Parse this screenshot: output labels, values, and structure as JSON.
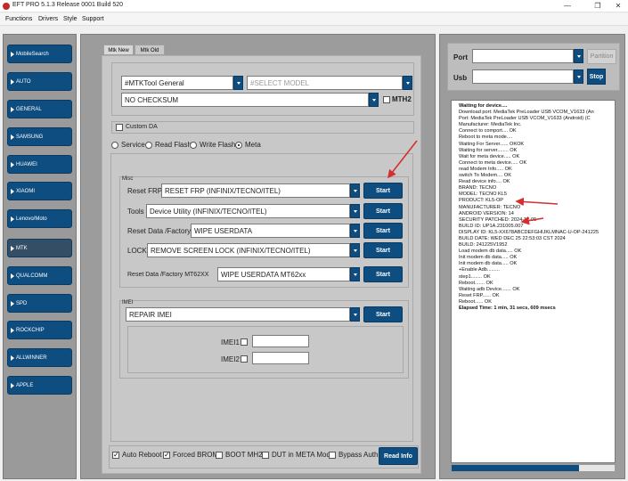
{
  "window": {
    "title": "EFT PRO 5.1.3 Release 0001 Build 520",
    "minimize": "—",
    "maximize": "❐",
    "close": "✕"
  },
  "menu": [
    "Functions",
    "Drivers",
    "Style",
    "Support"
  ],
  "sidebar": {
    "items": [
      "MobileSearch",
      "AUTO",
      "GENERAL",
      "SAMSUNG",
      "HUAWEI",
      "XIAOMI",
      "Lenovo/Moto",
      "MTK",
      "QUALCOMM",
      "SPD",
      "ROCKCHIP",
      "ALLWINNER",
      "APPLE"
    ],
    "active": "MTK"
  },
  "tabs": [
    "Mtk New",
    "Mtk Old"
  ],
  "selectors": {
    "tool": "#MTKTool General",
    "model_placeholder": "#SELECT MODEL",
    "checksum": "NO CHECKSUM",
    "mth2": "MTH2"
  },
  "custom_da": "Custom DA",
  "modes": [
    "Service",
    "Read Flash",
    "Write Flash",
    "Meta"
  ],
  "misc": {
    "title": "Misc",
    "rows": [
      {
        "label": "Reset FRP",
        "value": "RESET FRP (INFINIX/TECNO/ITEL)",
        "button": "Start"
      },
      {
        "label": "Tools",
        "value": "Device Utility (INFINIX/TECNO/ITEL)",
        "button": "Start"
      },
      {
        "label": "Reset Data /Factory",
        "value": "WIPE USERDATA",
        "button": "Start"
      },
      {
        "label": "LOCK",
        "value": "REMOVE SCREEN LOCK (INFINIX/TECNO/ITEL)",
        "button": "Start"
      },
      {
        "label": "Reset Data /Factory MT62XX",
        "value": "WIPE USERDATA  MT62xx",
        "button": "Start"
      }
    ]
  },
  "imei": {
    "title": "IMEI",
    "action": "REPAIR IMEI",
    "button": "Start",
    "imei1": "IMEI1",
    "imei2": "IMEI2"
  },
  "footer": {
    "auto_reboot": "Auto Reboot",
    "forced_brom": "Forced BROM",
    "boot_mh2": "BOOT MH2",
    "dut_meta": "DUT in META Mod",
    "bypass_auth": "Bypass Auth",
    "read_info": "Read Info"
  },
  "connection": {
    "port_label": "Port",
    "usb_label": "Usb",
    "partition": "Partition",
    "stop": "Stop"
  },
  "log": [
    {
      "t": "Waiting for device....",
      "b": true
    },
    {
      "t": "Download port: MediaTek PreLoader USB VCOM_V1633 (An",
      "b": false
    },
    {
      "t": "Port: MediaTek PreLoader USB VCOM_V1633 (Android) (C",
      "b": false
    },
    {
      "t": "Manufacturer: MediaTek Inc.",
      "b": false
    },
    {
      "t": "Connect to comport.... OK",
      "b": false
    },
    {
      "t": "Reboot to meta mode....",
      "b": false
    },
    {
      "t": "Waiting For Server...... OKOK",
      "b": false
    },
    {
      "t": "Waiting for server........ OK",
      "b": false
    },
    {
      "t": "Wait for meta device..... OK",
      "b": false
    },
    {
      "t": "Connect to meta device..... OK",
      "b": false
    },
    {
      "t": "read Modem Info..... OK",
      "b": false
    },
    {
      "t": "switch To Modem.... OK",
      "b": false
    },
    {
      "t": "Read device info.... OK",
      "b": false
    },
    {
      "t": "  BRAND: TECNO",
      "b": false
    },
    {
      "t": "  MODEL: TECNO KL5",
      "b": false
    },
    {
      "t": "  PRODUCT: KL5-OP",
      "b": false
    },
    {
      "t": "  MANUFACTURER: TECNO",
      "b": false
    },
    {
      "t": "  ANDROID VERSION: 14",
      "b": false
    },
    {
      "t": "  SECURITY PATCHED: 2024-12-05",
      "b": false
    },
    {
      "t": "  BUILD ID: UP1A.231005.007",
      "b": false
    },
    {
      "t": "  DISPLAY ID: KL5-XX678ABCDEFGHIJKLMNAC-U-OP-241225",
      "b": false
    },
    {
      "t": "  BUILD DATE: WED DEC 25 22:53:03 CST 2024",
      "b": false
    },
    {
      "t": "  BUILD: 241225V1952",
      "b": false
    },
    {
      "t": "Load modem db data..... OK",
      "b": false
    },
    {
      "t": "Init modem db data..... OK",
      "b": false
    },
    {
      "t": "Init modem db data..... OK",
      "b": false
    },
    {
      "t": "+Enable Adb.........",
      "b": false
    },
    {
      "t": "step1........ OK",
      "b": false
    },
    {
      "t": "Reboot....... OK",
      "b": false
    },
    {
      "t": "Waiting adb Device....... OK",
      "b": false
    },
    {
      "t": "Reset FRP...... OK",
      "b": false
    },
    {
      "t": "Reboot...... OK",
      "b": false
    },
    {
      "t": "Elapsed Time: 1 min, 31 secs, 609 msecs",
      "b": true
    }
  ],
  "progress": 0.78,
  "colors": {
    "accent": "#0e4d80",
    "annotation_arrow": "#d32f2f"
  }
}
